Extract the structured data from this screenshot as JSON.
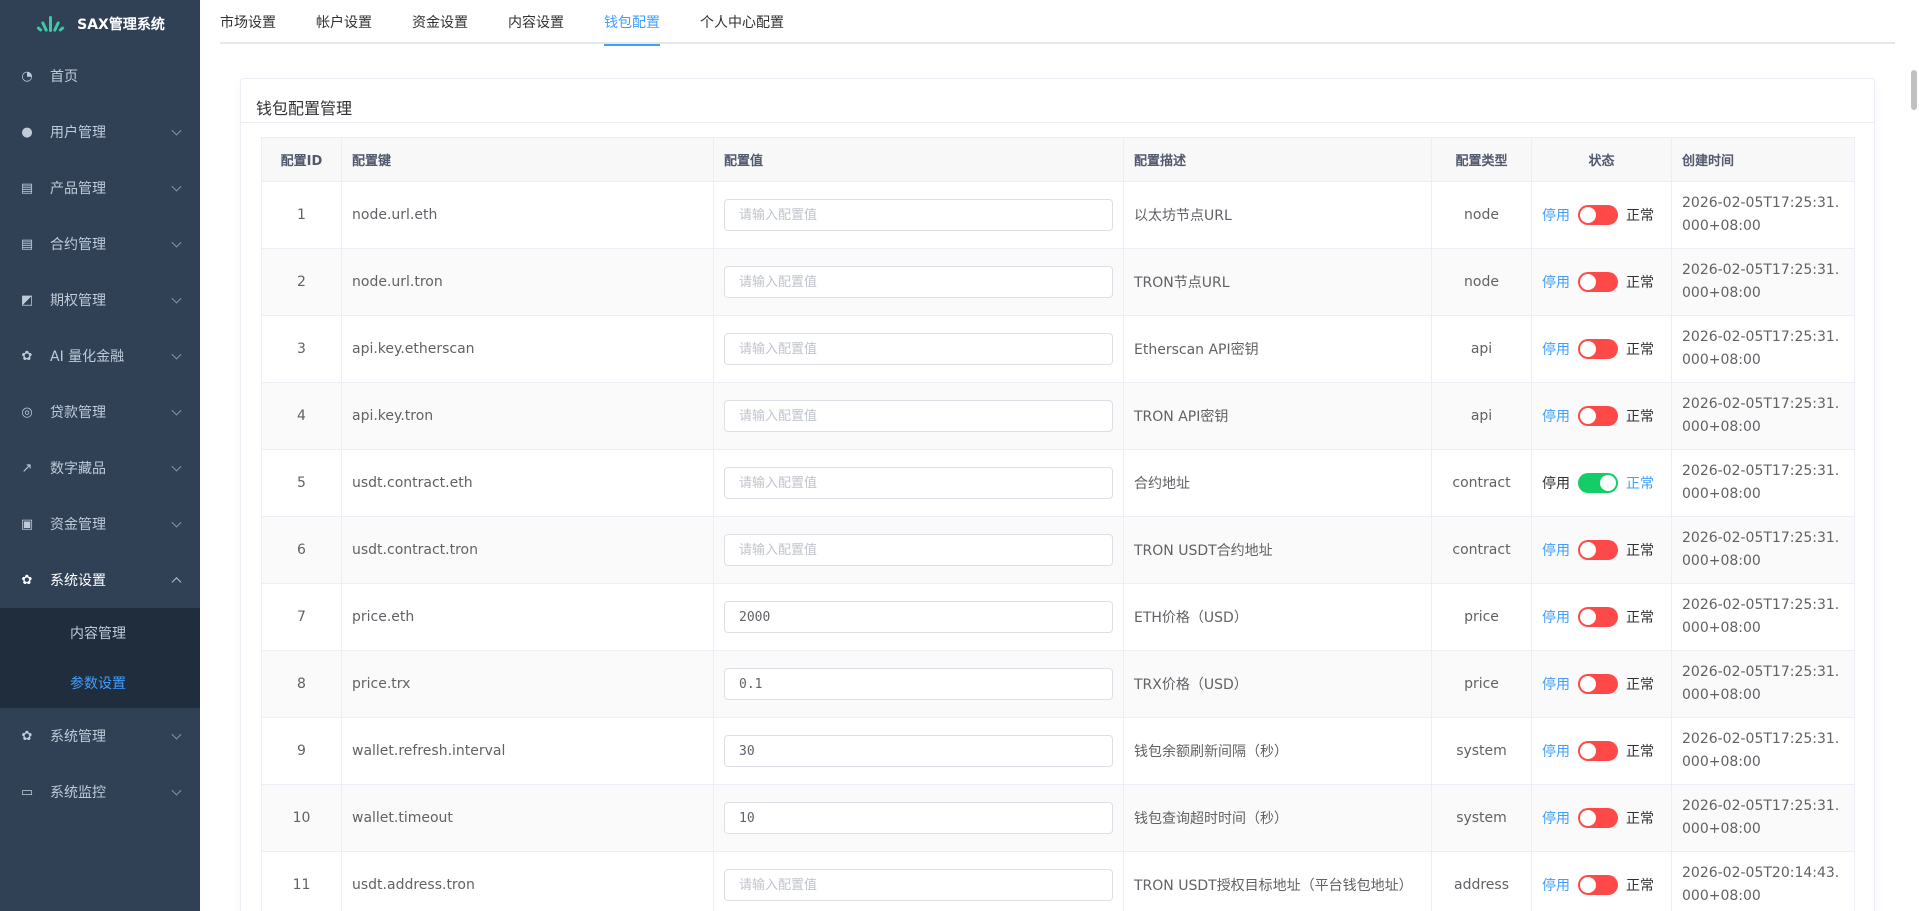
{
  "app": {
    "title": "SAX管理系统"
  },
  "sidebar": {
    "items": [
      {
        "label": "首页",
        "icon": "dashboard-icon",
        "expandable": false
      },
      {
        "label": "用户管理",
        "icon": "user-icon",
        "expandable": true
      },
      {
        "label": "产品管理",
        "icon": "document-icon",
        "expandable": true
      },
      {
        "label": "合约管理",
        "icon": "document-icon",
        "expandable": true
      },
      {
        "label": "期权管理",
        "icon": "chart-icon",
        "expandable": true
      },
      {
        "label": "AI 量化金融",
        "icon": "gear-icon",
        "expandable": true
      },
      {
        "label": "贷款管理",
        "icon": "coins-icon",
        "expandable": true
      },
      {
        "label": "数字藏品",
        "icon": "trend-icon",
        "expandable": true
      },
      {
        "label": "资金管理",
        "icon": "money-icon",
        "expandable": true
      },
      {
        "label": "系统设置",
        "icon": "gear-icon",
        "expandable": true,
        "open": true
      },
      {
        "label": "系统管理",
        "icon": "gear-icon",
        "expandable": true
      },
      {
        "label": "系统监控",
        "icon": "monitor-icon",
        "expandable": true
      }
    ],
    "submenu": [
      {
        "label": "内容管理",
        "active": false
      },
      {
        "label": "参数设置",
        "active": true
      }
    ]
  },
  "tabs": [
    {
      "label": "市场设置",
      "active": false
    },
    {
      "label": "帐户设置",
      "active": false
    },
    {
      "label": "资金设置",
      "active": false
    },
    {
      "label": "内容设置",
      "active": false
    },
    {
      "label": "钱包配置",
      "active": true
    },
    {
      "label": "个人中心配置",
      "active": false
    }
  ],
  "card": {
    "title": "钱包配置管理"
  },
  "table": {
    "headers": [
      "配置ID",
      "配置键",
      "配置值",
      "配置描述",
      "配置类型",
      "状态",
      "创建时间"
    ],
    "placeholder": "请输入配置值",
    "rows": [
      {
        "id": "1",
        "key": "node.url.eth",
        "value": "",
        "desc": "以太坊节点URL",
        "type": "node",
        "on": false,
        "time": "2026-02-05T17:25:31.000+08:00"
      },
      {
        "id": "2",
        "key": "node.url.tron",
        "value": "",
        "desc": "TRON节点URL",
        "type": "node",
        "on": false,
        "time": "2026-02-05T17:25:31.000+08:00"
      },
      {
        "id": "3",
        "key": "api.key.etherscan",
        "value": "",
        "desc": "Etherscan API密钥",
        "type": "api",
        "on": false,
        "time": "2026-02-05T17:25:31.000+08:00"
      },
      {
        "id": "4",
        "key": "api.key.tron",
        "value": "",
        "desc": "TRON API密钥",
        "type": "api",
        "on": false,
        "time": "2026-02-05T17:25:31.000+08:00"
      },
      {
        "id": "5",
        "key": "usdt.contract.eth",
        "value": "",
        "desc": "合约地址",
        "type": "contract",
        "on": true,
        "time": "2026-02-05T17:25:31.000+08:00"
      },
      {
        "id": "6",
        "key": "usdt.contract.tron",
        "value": "",
        "desc": "TRON USDT合约地址",
        "type": "contract",
        "on": false,
        "time": "2026-02-05T17:25:31.000+08:00"
      },
      {
        "id": "7",
        "key": "price.eth",
        "value": "2000",
        "desc": "ETH价格（USD）",
        "type": "price",
        "on": false,
        "time": "2026-02-05T17:25:31.000+08:00"
      },
      {
        "id": "8",
        "key": "price.trx",
        "value": "0.1",
        "desc": "TRX价格（USD）",
        "type": "price",
        "on": false,
        "time": "2026-02-05T17:25:31.000+08:00"
      },
      {
        "id": "9",
        "key": "wallet.refresh.interval",
        "value": "30",
        "desc": "钱包余额刷新间隔（秒）",
        "type": "system",
        "on": false,
        "time": "2026-02-05T17:25:31.000+08:00"
      },
      {
        "id": "10",
        "key": "wallet.timeout",
        "value": "10",
        "desc": "钱包查询超时时间（秒）",
        "type": "system",
        "on": false,
        "time": "2026-02-05T17:25:31.000+08:00"
      },
      {
        "id": "11",
        "key": "usdt.address.tron",
        "value": "",
        "desc": "TRON USDT授权目标地址（平台钱包地址）",
        "type": "address",
        "on": false,
        "time": "2026-02-05T20:14:43.000+08:00"
      }
    ]
  },
  "status_labels": {
    "disable": "停用",
    "normal": "正常"
  },
  "colors": {
    "sidebar_bg": "#304156",
    "submenu_bg": "#1f2d3d",
    "accent": "#409eff",
    "switch_off": "#ff4949",
    "switch_on": "#13ce66"
  }
}
